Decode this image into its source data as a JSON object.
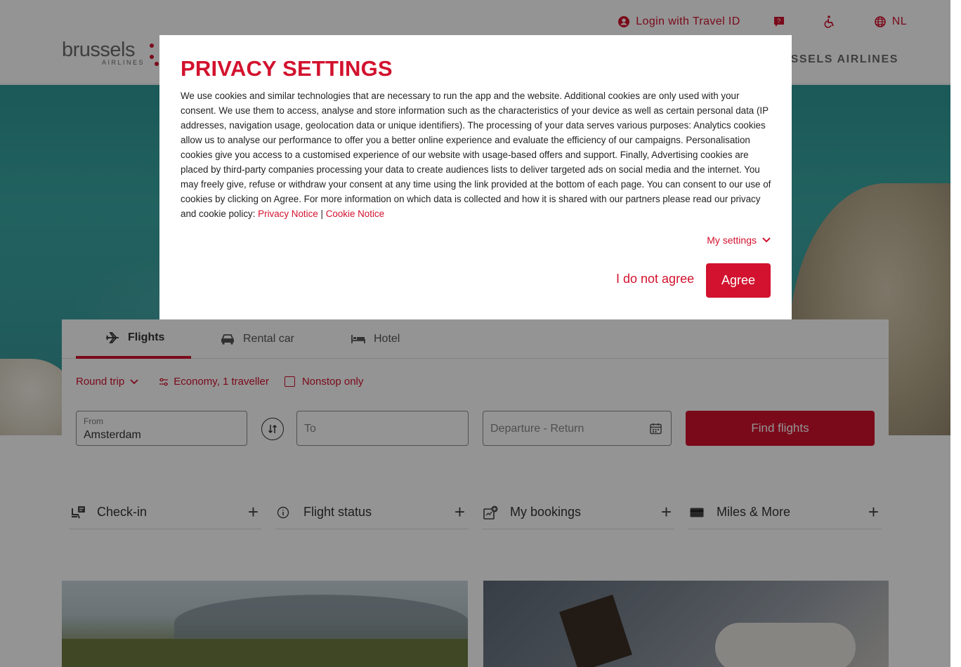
{
  "header": {
    "login_label": "Login with Travel ID",
    "language_label": "NL",
    "logo_word": "brussels",
    "logo_sub": "AIRLINES",
    "nav_right": "SSELS AIRLINES"
  },
  "booking": {
    "tabs": [
      {
        "label": "Flights",
        "icon": "plane-icon"
      },
      {
        "label": "Rental car",
        "icon": "car-icon"
      },
      {
        "label": "Hotel",
        "icon": "bed-icon"
      }
    ],
    "trip_type": "Round trip",
    "cabin_travellers": "Economy, 1 traveller",
    "nonstop_label": "Nonstop only",
    "from_label": "From",
    "from_value": "Amsterdam",
    "to_placeholder": "To",
    "dates_placeholder": "Departure - Return",
    "find_label": "Find flights"
  },
  "quick_links": [
    {
      "label": "Check-in",
      "icon": "checkin-seat-icon"
    },
    {
      "label": "Flight status",
      "icon": "info-circle-icon"
    },
    {
      "label": "My bookings",
      "icon": "bookings-icon"
    },
    {
      "label": "Miles & More",
      "icon": "card-icon"
    }
  ],
  "privacy": {
    "title": "PRIVACY SETTINGS",
    "body": "We use cookies and similar technologies that are necessary to run the app and the website. Additional cookies are only used with your consent. We use them to access, analyse and store information such as the characteristics of your device as well as certain personal data (IP addresses, navigation usage, geolocation data or unique identifiers). The processing of your data serves various purposes: Analytics cookies allow us to analyse our performance to offer you a better online experience and evaluate the efficiency of our campaigns. Personalisation cookies give you access to a customised experience of our website with usage-based offers and support. Finally, Advertising cookies are placed by third-party companies processing your data to create audiences lists to deliver targeted ads on social media and the internet. You may freely give, refuse or withdraw your consent at any time using the link provided at the bottom of each page. You can consent to our use of cookies by clicking on Agree. For more information on which data is collected and how it is shared with our partners please read our privacy and cookie policy: ",
    "privacy_link": "Privacy Notice",
    "separator": "|",
    "cookie_link": "Cookie Notice",
    "my_settings": "My settings",
    "disagree_label": "I do not agree",
    "agree_label": "Agree"
  },
  "colors": {
    "brand_red": "#d2122e",
    "overlay": "rgba(0,0,0,0.42)"
  }
}
